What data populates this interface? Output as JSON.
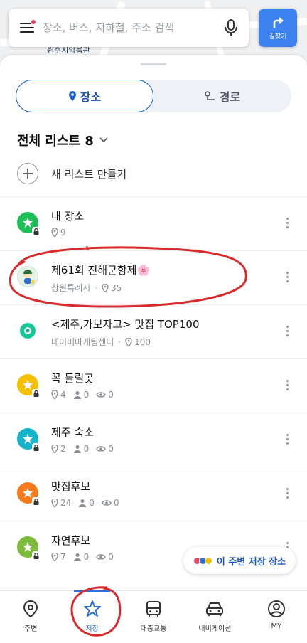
{
  "map": {
    "label": "원주시악읍관"
  },
  "search": {
    "placeholder": "장소, 버스, 지하철, 주소 검색",
    "menu_icon": "menu-icon",
    "mic_icon": "mic-icon"
  },
  "route_button": {
    "label": "길찾기",
    "icon": "turn-arrow-icon"
  },
  "segments": {
    "place": "장소",
    "route": "경로"
  },
  "list_header": {
    "title": "전체 리스트 8"
  },
  "new_list": {
    "label": "새 리스트 만들기"
  },
  "lists": [
    {
      "title": "내 장소",
      "places": "9",
      "color": "#1fbf58"
    },
    {
      "title": "제61회 진해군항제🌸",
      "owner": "창원특례시",
      "places": "35"
    },
    {
      "title": "<제주,가보자고> 맛집 TOP100",
      "owner": "네이버마케팅센터",
      "places": "100"
    },
    {
      "title": "꼭 들릴곳",
      "places": "4",
      "followers": "0",
      "views": "0",
      "color": "#f5c000"
    },
    {
      "title": "제주 숙소",
      "places": "2",
      "followers": "0",
      "views": "0",
      "color": "#14b3c9"
    },
    {
      "title": "맛집후보",
      "places": "24",
      "followers": "0",
      "views": "0",
      "color": "#f57a1b"
    },
    {
      "title": "자연후보",
      "places": "7",
      "followers": "0",
      "views": "0",
      "color": "#7cbb3b"
    }
  ],
  "nearby": {
    "label": "이 주변 저장 장소"
  },
  "nav": {
    "nearby": "주변",
    "saved": "저장",
    "transit": "대중교통",
    "navigation": "내비게이션",
    "my": "MY"
  },
  "colors": {
    "accent": "#2f6fdc",
    "annotation": "#d92b2b"
  }
}
